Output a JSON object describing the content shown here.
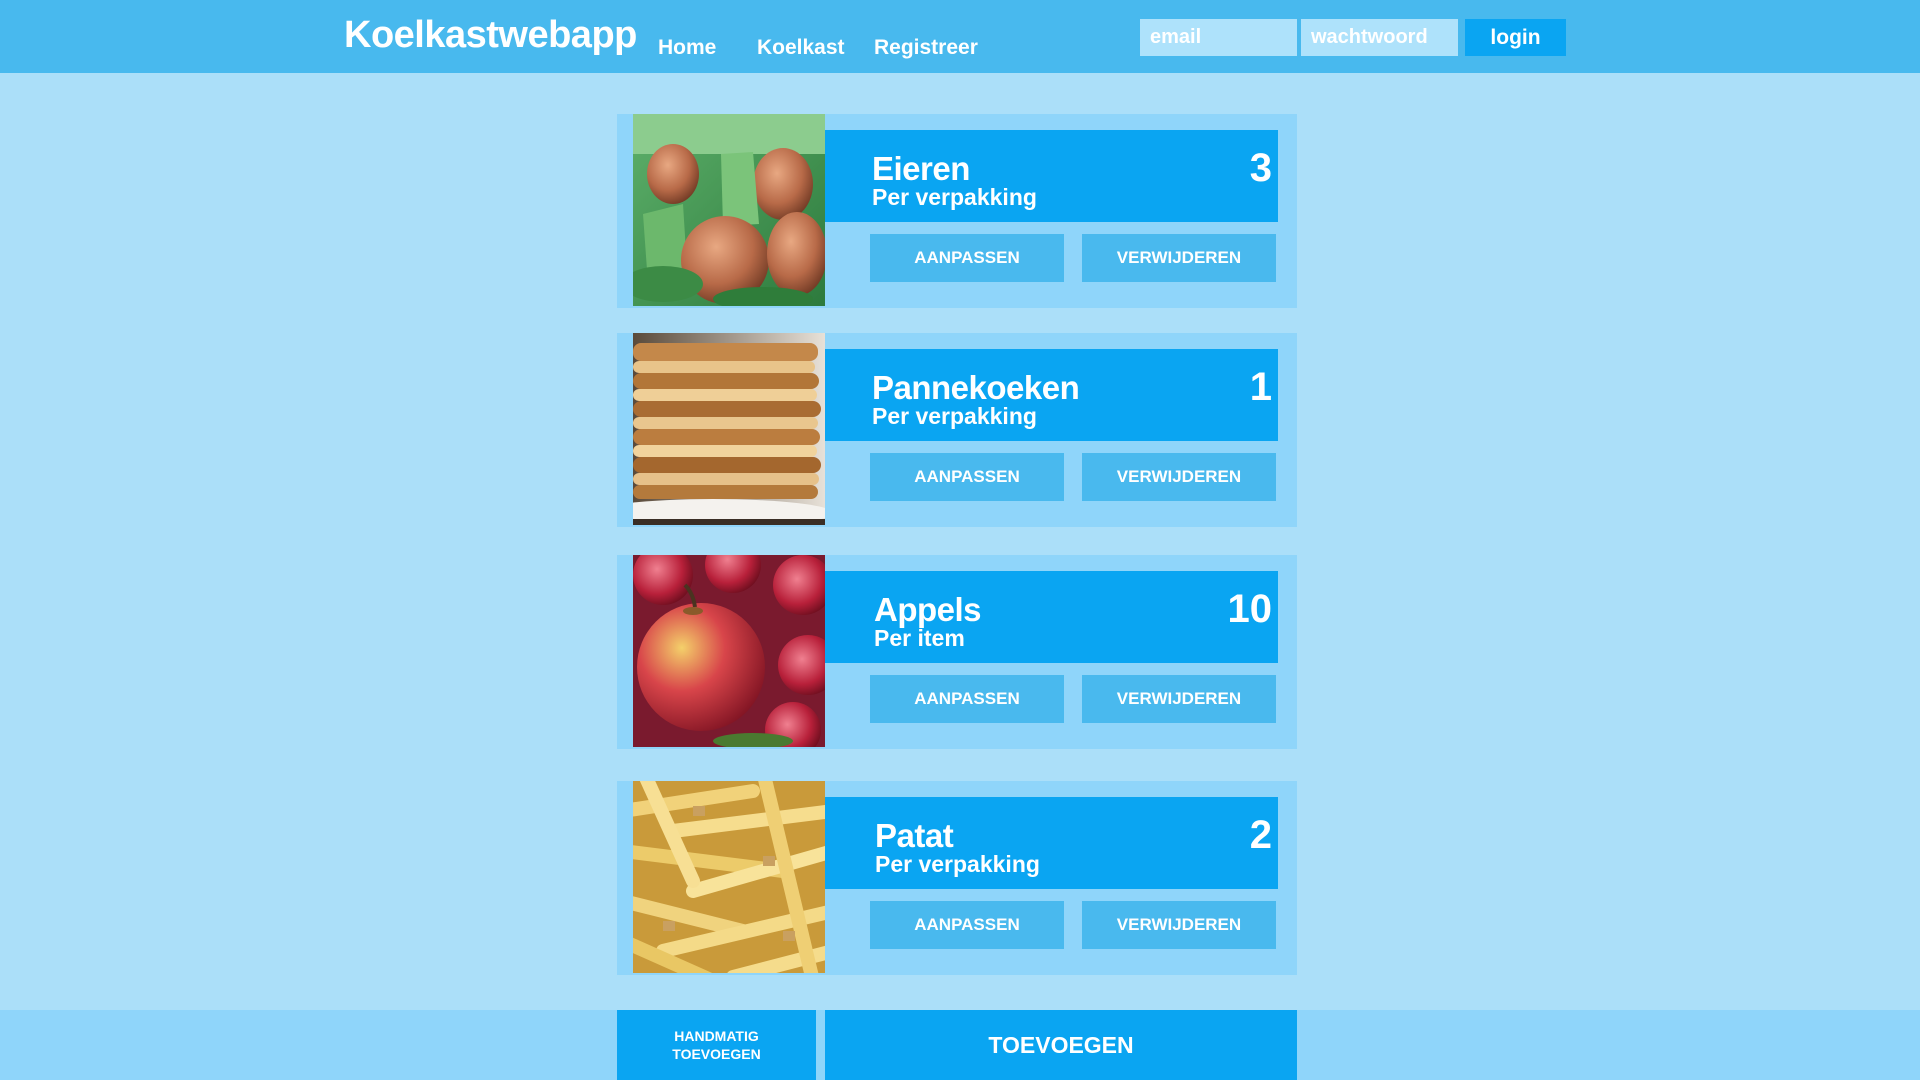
{
  "header": {
    "brand": "Koelkastwebapp",
    "nav": [
      "Home",
      "Koelkast",
      "Registreer"
    ],
    "email_placeholder": "email",
    "password_placeholder": "wachtwoord",
    "login_label": "login"
  },
  "items": [
    {
      "name": "Eieren",
      "unit": "Per verpakking",
      "count": "3",
      "image": "eggs-photo",
      "edit_label": "AANPASSEN",
      "delete_label": "VERWIJDEREN"
    },
    {
      "name": "Pannekoeken",
      "unit": "Per verpakking",
      "count": "1",
      "image": "pancakes-photo",
      "edit_label": "AANPASSEN",
      "delete_label": "VERWIJDEREN"
    },
    {
      "name": "Appels",
      "unit": "Per item",
      "count": "10",
      "image": "apples-photo",
      "edit_label": "AANPASSEN",
      "delete_label": "VERWIJDEREN"
    },
    {
      "name": "Patat",
      "unit": "Per verpakking",
      "count": "2",
      "image": "fries-photo",
      "edit_label": "AANPASSEN",
      "delete_label": "VERWIJDEREN"
    }
  ],
  "footer": {
    "manual_add_label": "HANDMATIG\nTOEVOEGEN",
    "add_label": "TOEVOEGEN"
  },
  "colors": {
    "page_bg": "#abdff9",
    "header_bg": "#48b9ee",
    "card_bg": "#8fd5fa",
    "accent": "#0aa5f2",
    "button": "#49b9ee"
  }
}
